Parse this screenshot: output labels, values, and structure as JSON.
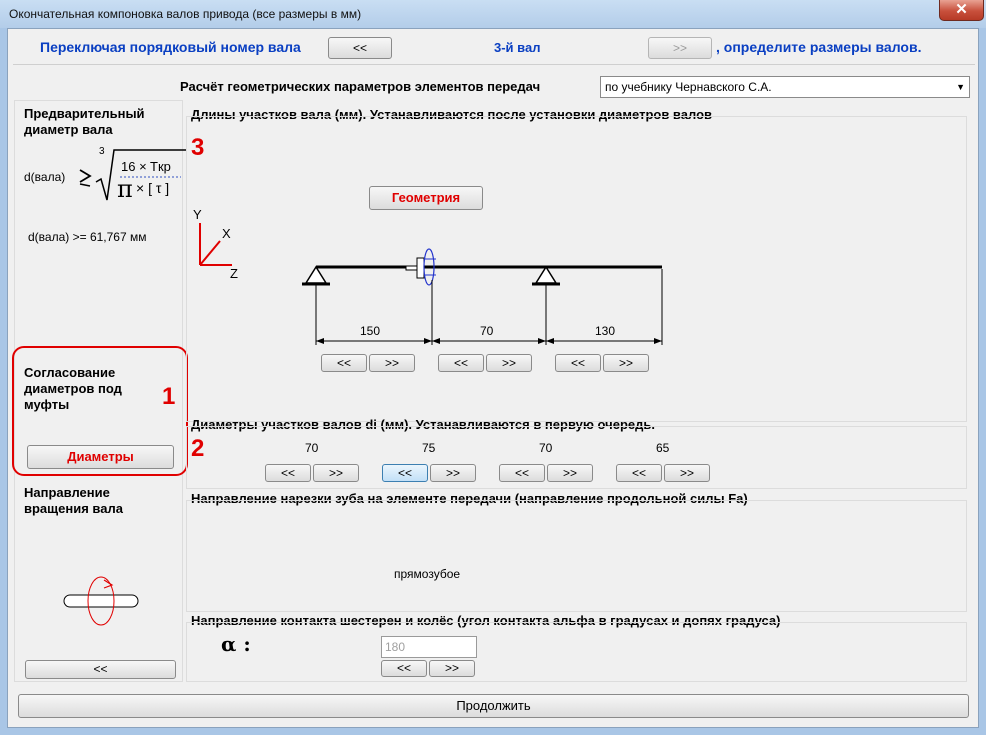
{
  "window": {
    "title": "Окончательная компоновка валов привода (все размеры в мм)",
    "close_glyph": "✕"
  },
  "header": {
    "prefix": "Переключая порядковый номер вала",
    "prev_label": "<<",
    "shaft_label": "3-й вал",
    "next_label": ">>",
    "suffix": ", определите размеры валов."
  },
  "calc": {
    "label": "Расчёт геометрических параметров элементов передач",
    "selected": "по учебнику Чернавского С.А."
  },
  "left": {
    "prelim_title_1": "Предварительный",
    "prelim_title_2": "диаметр вала",
    "formula_lhs": "d(вала)",
    "formula_root": "3",
    "formula_num": "16 × Tкр",
    "formula_pi": "π",
    "formula_tau": "× [ τ ]",
    "result": "d(вала) >= 61,767 мм",
    "coord_title_1": "Согласование",
    "coord_title_2": "диаметров под",
    "coord_title_3": "муфты",
    "diameters_button": "Диаметры",
    "rotation_title_1": "Направление",
    "rotation_title_2": "вращения вала",
    "back_label": "<<"
  },
  "annotations": {
    "one": "1",
    "two": "2",
    "three": "3"
  },
  "lengths": {
    "title": "Длины участков вала (мм). Устанавливаются после установки диаметров валов",
    "geometry_button": "Геометрия",
    "axis_y": "Y",
    "axis_x": "X",
    "axis_z": "Z",
    "values": [
      "150",
      "70",
      "130"
    ],
    "dec": "<<",
    "inc": ">>"
  },
  "diameters": {
    "title": "Диаметры участков валов di (мм). Устанавливаются в первую очередь.",
    "values": [
      "70",
      "75",
      "70",
      "65"
    ],
    "dec": "<<",
    "inc": ">>"
  },
  "tooth": {
    "title": "Направление нарезки зуба на элементе передачи (направление продольной силы Fa)",
    "value": "прямозубое"
  },
  "contact": {
    "title": "Направление контакта шестерен и колёс (угол контакта альфа в градусах и допях градуса)",
    "alpha": "α :",
    "angle": "180",
    "dec": "<<",
    "inc": ">>"
  },
  "footer": {
    "continue": "Продолжить"
  },
  "colors": {
    "accent_blue": "#0a3fc2",
    "accent_red": "#e00000"
  }
}
